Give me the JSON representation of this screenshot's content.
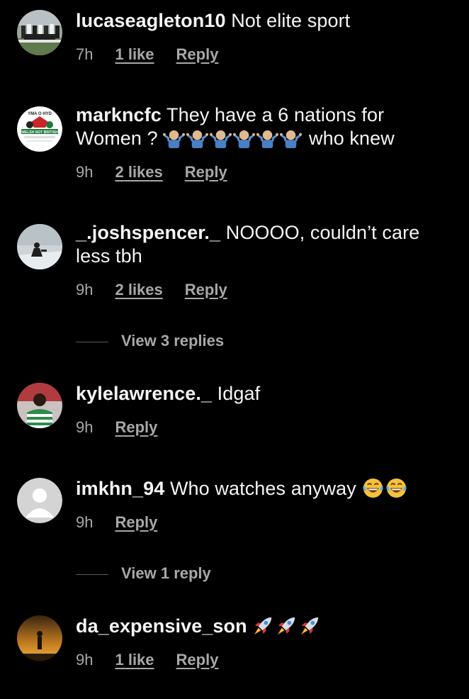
{
  "comments": [
    {
      "username": "lucaseagleton10",
      "text": "Not elite sport",
      "time": "7h",
      "likes": "1 like",
      "reply": "Reply"
    },
    {
      "username": "markncfc",
      "text_before": "They have a 6 nations for Women ?",
      "emoji": "person-shrugging-emoji",
      "emoji_count": 6,
      "text_after": "who knew",
      "time": "9h",
      "likes": "2 likes",
      "reply": "Reply",
      "avatar_text_top": "YMA O HYD",
      "avatar_text_bottom": "WELSH NOT BRITISH"
    },
    {
      "username": "_.joshspencer._",
      "text": "NOOOO, couldn’t care less tbh",
      "time": "9h",
      "likes": "2 likes",
      "reply": "Reply",
      "view_replies": "View 3 replies"
    },
    {
      "username": "kylelawrence._",
      "text": "Idgaf",
      "time": "9h",
      "reply": "Reply"
    },
    {
      "username": "imkhn_94",
      "text": "Who watches anyway",
      "emoji": "face-with-tears-of-joy-emoji",
      "emoji_count": 2,
      "time": "9h",
      "reply": "Reply",
      "view_replies": "View 1 reply"
    },
    {
      "username": "da_expensive_son",
      "emoji": "rocket-emoji",
      "emoji_count": 3,
      "time": "9h",
      "likes": "1 like",
      "reply": "Reply"
    }
  ],
  "colors": {
    "background": "#000000",
    "text": "#f5f5f5",
    "secondary": "#a8a8a8"
  }
}
